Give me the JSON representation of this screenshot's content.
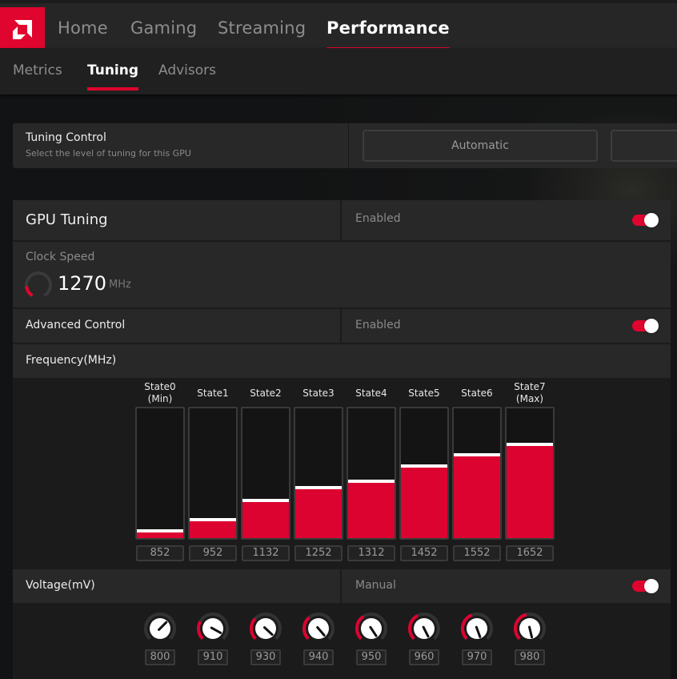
{
  "nav": {
    "logo": "amd-logo",
    "tabs": [
      {
        "label": "Home",
        "active": false
      },
      {
        "label": "Gaming",
        "active": false
      },
      {
        "label": "Streaming",
        "active": false
      },
      {
        "label": "Performance",
        "active": true
      }
    ],
    "subtabs": [
      {
        "label": "Metrics",
        "active": false
      },
      {
        "label": "Tuning",
        "active": true
      },
      {
        "label": "Advisors",
        "active": false
      }
    ]
  },
  "tuning_control": {
    "title": "Tuning Control",
    "subtitle": "Select the level of tuning for this GPU",
    "buttons": [
      "Automatic",
      ""
    ]
  },
  "gpu_tuning": {
    "title": "GPU Tuning",
    "status": "Enabled",
    "toggle_on": true,
    "clock_speed": {
      "label": "Clock Speed",
      "value": "1270",
      "unit": "MHz",
      "gauge_fraction": 0.25
    },
    "advanced_control": {
      "label": "Advanced Control",
      "status": "Enabled",
      "toggle_on": true
    },
    "frequency": {
      "label": "Frequency(MHz)",
      "range_min": 800,
      "range_max": 2000,
      "states": [
        {
          "label": "State0",
          "sub": "(Min)",
          "value": "852"
        },
        {
          "label": "State1",
          "sub": "",
          "value": "952"
        },
        {
          "label": "State2",
          "sub": "",
          "value": "1132"
        },
        {
          "label": "State3",
          "sub": "",
          "value": "1252"
        },
        {
          "label": "State4",
          "sub": "",
          "value": "1312"
        },
        {
          "label": "State5",
          "sub": "",
          "value": "1452"
        },
        {
          "label": "State6",
          "sub": "",
          "value": "1552"
        },
        {
          "label": "State7",
          "sub": "(Max)",
          "value": "1652"
        }
      ]
    },
    "voltage": {
      "label": "Voltage(mV)",
      "status": "Manual",
      "toggle_on": true,
      "range_min": 800,
      "range_max": 1200,
      "states": [
        {
          "value": "800"
        },
        {
          "value": "910"
        },
        {
          "value": "930"
        },
        {
          "value": "940"
        },
        {
          "value": "950"
        },
        {
          "value": "960"
        },
        {
          "value": "970"
        },
        {
          "value": "980"
        }
      ]
    }
  },
  "colors": {
    "accent": "#e0052e",
    "panel": "#282828",
    "background": "#121314"
  }
}
